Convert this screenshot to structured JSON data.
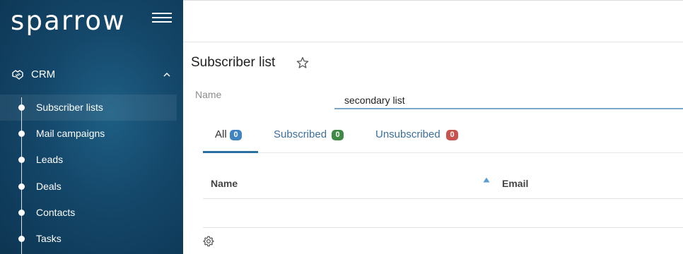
{
  "sidebar": {
    "logo": "sparrow",
    "menu_icon": "hamburger-menu-icon",
    "section": {
      "label": "CRM",
      "icon": "handshake-icon",
      "chevron": "chevron-up-icon"
    },
    "items": [
      {
        "label": "Subscriber lists",
        "active": true
      },
      {
        "label": "Mail campaigns",
        "active": false
      },
      {
        "label": "Leads",
        "active": false
      },
      {
        "label": "Deals",
        "active": false
      },
      {
        "label": "Contacts",
        "active": false
      },
      {
        "label": "Tasks",
        "active": false
      }
    ]
  },
  "page": {
    "title": "Subscriber list",
    "favorite_icon": "star-outline-icon"
  },
  "form": {
    "name_label": "Name",
    "name_value": "secondary list"
  },
  "tabs": [
    {
      "label": "All",
      "count": "0",
      "color": "#3f84c0",
      "active": true
    },
    {
      "label": "Subscribed",
      "count": "0",
      "color": "#3f8a45",
      "active": false
    },
    {
      "label": "Unsubscribed",
      "count": "0",
      "color": "#c9534f",
      "active": false
    }
  ],
  "table": {
    "columns": [
      "Name",
      "Email"
    ],
    "sort_icon": "sort-ascending-icon",
    "settings_icon": "gear-icon"
  },
  "colors": {
    "sidebar_bg": "#14476a",
    "accent": "#2b6ea0",
    "input_underline": "#7da7c6"
  }
}
